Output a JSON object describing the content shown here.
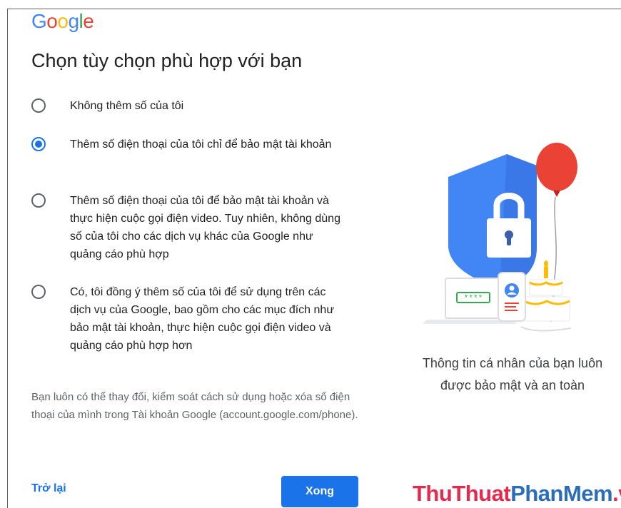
{
  "logo": {
    "letters": [
      "G",
      "o",
      "o",
      "g",
      "l",
      "e"
    ],
    "colors": [
      "#4285f4",
      "#ea4335",
      "#fbbc05",
      "#4285f4",
      "#34a853",
      "#ea4335"
    ]
  },
  "page": {
    "title": "Chọn tùy chọn phù hợp với bạn"
  },
  "options": [
    {
      "label": "Không thêm số của tôi",
      "checked": false
    },
    {
      "label": "Thêm số điện thoại của tôi chỉ để bảo mật tài khoản",
      "checked": true
    },
    {
      "label": "Thêm số điện thoại của tôi để bảo mật tài khoản và thực hiện cuộc gọi điện video. Tuy nhiên, không dùng số của tôi cho các dịch vụ khác của Google như quảng cáo phù hợp",
      "checked": false
    },
    {
      "label": "Có, tôi đồng ý thêm số của tôi để sử dụng trên các dịch vụ của Google, bao gồm cho các mục đích như bảo mật tài khoản, thực hiện cuộc gọi điện video và quảng cáo phù hợp hơn",
      "checked": false
    }
  ],
  "note": "Bạn luôn có thể thay đổi, kiểm soát cách sử dụng hoặc xóa số điện thoại của mình trong Tài khoản Google (account.google.com/phone).",
  "illustration": {
    "caption": "Thông tin cá nhân của bạn luôn được bảo mật và an toàn",
    "password_mask": "****"
  },
  "buttons": {
    "back": "Trở lại",
    "done": "Xong"
  },
  "watermark": {
    "part1": "ThuThuat",
    "part2": "PhanMem",
    "part3": ".vn"
  },
  "colors": {
    "accent": "#1a73e8",
    "shield": "#4285f4",
    "balloon": "#ea4335"
  },
  "icons": [
    "radio-icon",
    "shield-lock-icon",
    "balloon-icon",
    "cake-icon",
    "laptop-icon",
    "phone-icon"
  ]
}
